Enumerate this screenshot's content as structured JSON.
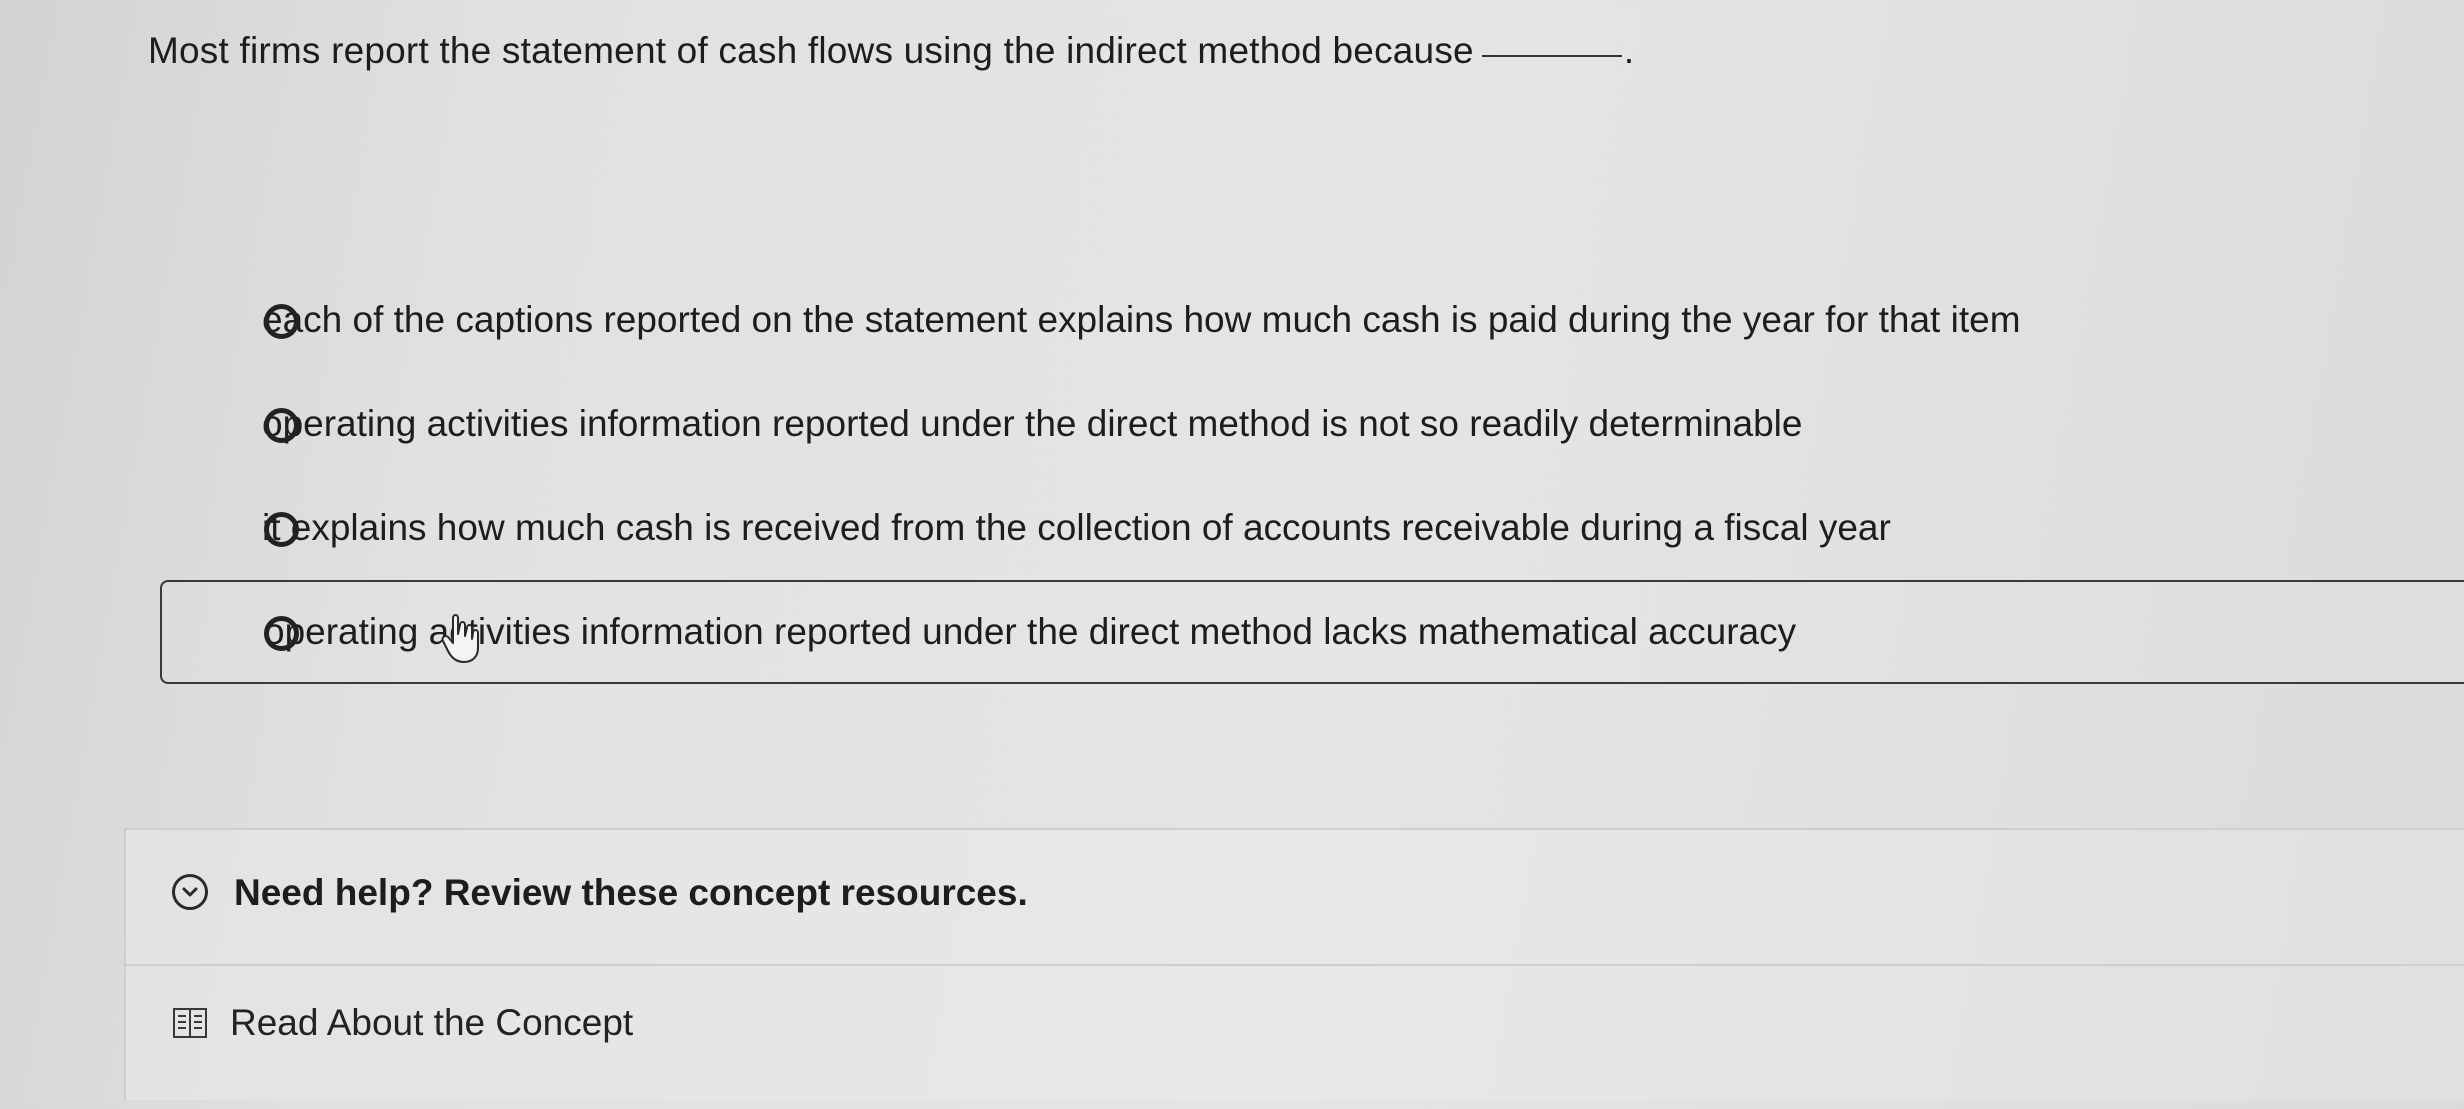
{
  "question": {
    "text": "Most firms report the statement of cash flows using the indirect method because",
    "end": "."
  },
  "options": [
    {
      "label": "each of the captions reported on the statement explains how much cash is paid during the year for that item"
    },
    {
      "label": "operating activities information reported under the direct method is not so readily determinable"
    },
    {
      "label": "it explains how much cash is received from the collection of accounts receivable during a fiscal year"
    },
    {
      "label": "operating activities information reported under the direct method lacks mathematical accuracy"
    }
  ],
  "help": {
    "title": "Need help? Review these concept resources.",
    "read_link": "Read About the Concept"
  },
  "icons": {
    "radio": "radio-unselected-icon",
    "expand": "chevron-down-circle-icon",
    "book": "book-icon",
    "cursor": "hand-pointer-icon"
  }
}
